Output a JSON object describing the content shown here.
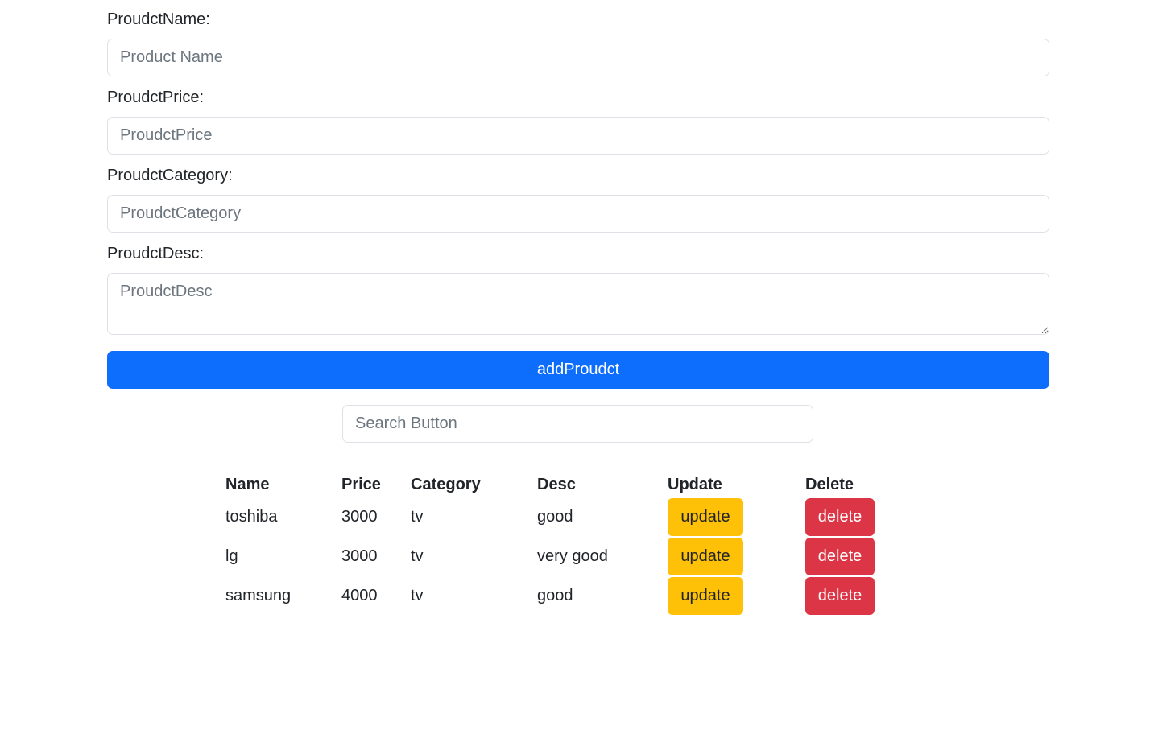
{
  "form": {
    "name_label": "ProudctName:",
    "name_placeholder": "Product Name",
    "price_label": "ProudctPrice:",
    "price_placeholder": "ProudctPrice",
    "category_label": "ProudctCategory:",
    "category_placeholder": "ProudctCategory",
    "desc_label": "ProudctDesc:",
    "desc_placeholder": "ProudctDesc",
    "add_button_label": "addProudct"
  },
  "search": {
    "placeholder": "Search Button"
  },
  "table": {
    "headers": [
      "Name",
      "Price",
      "Category",
      "Desc",
      "Update",
      "Delete"
    ],
    "rows": [
      {
        "name": "toshiba",
        "price": "3000",
        "category": "tv",
        "desc": "good",
        "update_label": "update",
        "delete_label": "delete"
      },
      {
        "name": "lg",
        "price": "3000",
        "category": "tv",
        "desc": "very good",
        "update_label": "update",
        "delete_label": "delete"
      },
      {
        "name": "samsung",
        "price": "4000",
        "category": "tv",
        "desc": "good",
        "update_label": "update",
        "delete_label": "delete"
      }
    ]
  },
  "colors": {
    "primary": "#0d6efd",
    "warning": "#ffc107",
    "danger": "#dc3545"
  }
}
